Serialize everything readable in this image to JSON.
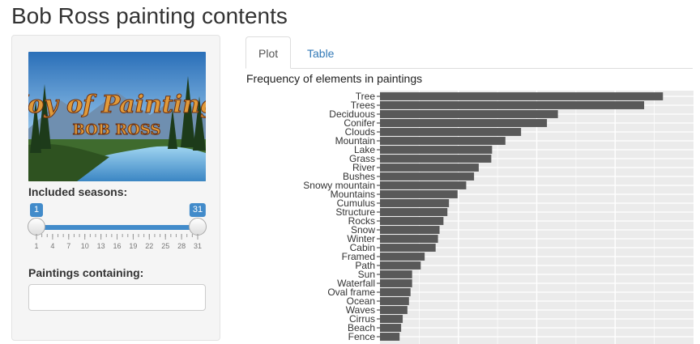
{
  "page": {
    "title": "Bob Ross painting contents"
  },
  "sidebar": {
    "logo_alt": "The Joy of Painting with Bob Ross",
    "seasons_label": "Included seasons:",
    "seasons_range": {
      "min": 1,
      "max": 31,
      "selected": [
        1,
        31
      ]
    },
    "seasons_ticks": [
      "1",
      "4",
      "7",
      "10",
      "13",
      "16",
      "19",
      "22",
      "25",
      "28",
      "31"
    ],
    "min_badge": "1",
    "max_badge": "31",
    "contains_label": "Paintings containing:",
    "contains_value": ""
  },
  "tabs": [
    {
      "label": "Plot",
      "active": true
    },
    {
      "label": "Table",
      "active": false
    }
  ],
  "chart_data": {
    "type": "bar",
    "orientation": "horizontal",
    "title": "Frequency of elements in paintings",
    "categories": [
      "Tree",
      "Trees",
      "Deciduous",
      "Conifer",
      "Clouds",
      "Mountain",
      "Lake",
      "Grass",
      "River",
      "Bushes",
      "Snowy mountain",
      "Mountains",
      "Cumulus",
      "Structure",
      "Rocks",
      "Snow",
      "Winter",
      "Cabin",
      "Framed",
      "Path",
      "Sun",
      "Waterfall",
      "Oval frame",
      "Ocean",
      "Waves",
      "Cirrus",
      "Beach",
      "Fence"
    ],
    "values": [
      361,
      337,
      227,
      213,
      180,
      160,
      143,
      142,
      126,
      120,
      110,
      99,
      88,
      86,
      81,
      76,
      74,
      71,
      57,
      52,
      41,
      41,
      39,
      37,
      35,
      29,
      27,
      25
    ],
    "xlim": [
      0,
      400
    ],
    "grid": true,
    "bar_color": "#595959",
    "panel_color": "#ebebeb"
  }
}
